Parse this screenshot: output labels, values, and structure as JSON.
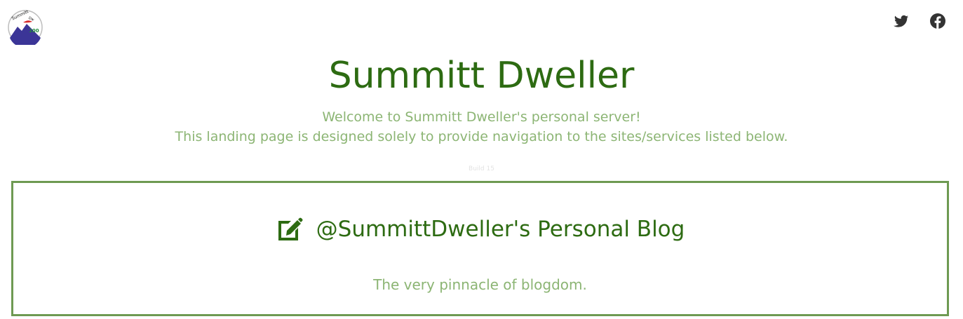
{
  "header": {
    "logo_name": "summitt-dweller-logo",
    "logo_text": "Summitt Dweller 100",
    "social": [
      {
        "icon": "twitter-icon",
        "label": "Twitter"
      },
      {
        "icon": "facebook-icon",
        "label": "Facebook"
      }
    ]
  },
  "hero": {
    "title": "Summitt Dweller",
    "subtitle_line1": "Welcome to Summitt Dweller's personal server!",
    "subtitle_line2": "This landing page is designed solely to provide navigation to the sites/services listed below.",
    "build": "Build 15"
  },
  "cards": [
    {
      "icon": "edit-icon",
      "title": "@SummittDweller's Personal Blog",
      "description": "The very pinnacle of blogdom."
    }
  ],
  "colors": {
    "title": "#2d6b12",
    "subtitle": "#8cb574",
    "card_border": "#6e9a52",
    "social_icon": "#333333"
  }
}
